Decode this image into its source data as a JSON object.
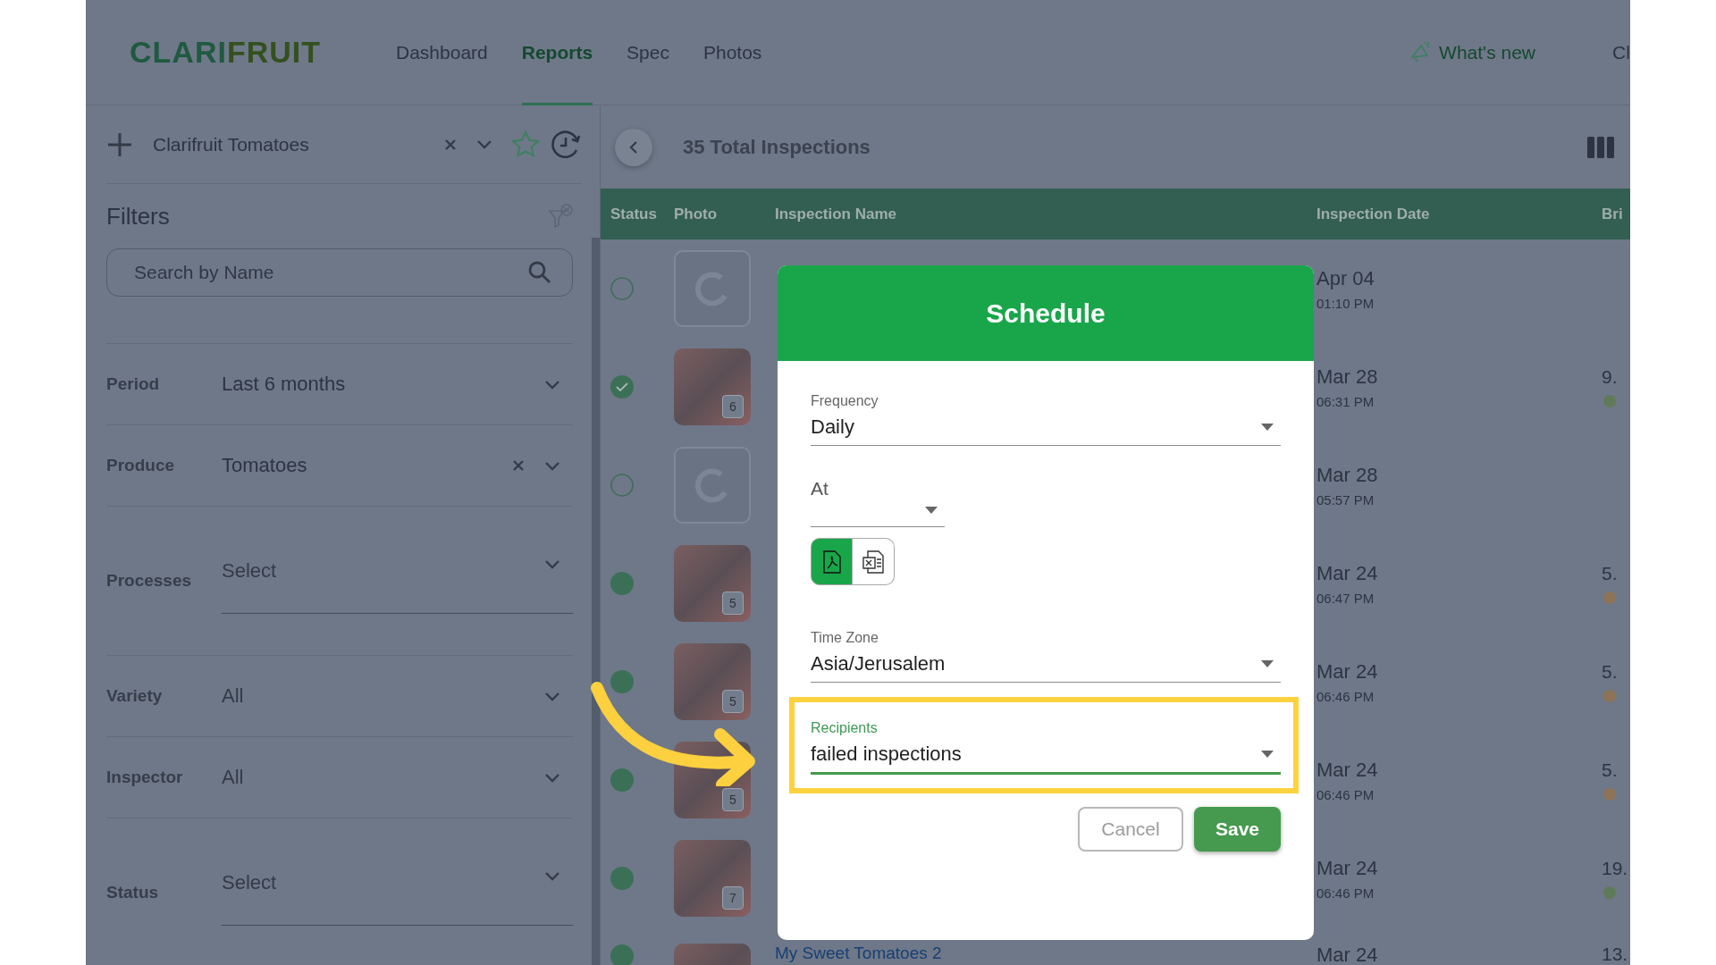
{
  "header": {
    "logo_parts": [
      "CLARI",
      "FRUIT"
    ],
    "nav": [
      {
        "label": "Dashboard",
        "selected": false
      },
      {
        "label": "Reports",
        "selected": true
      },
      {
        "label": "Spec",
        "selected": false
      },
      {
        "label": "Photos",
        "selected": false
      }
    ],
    "whats_new": "What's new",
    "cut_item": "Cl"
  },
  "sidebar": {
    "report_name": "Clarifruit Tomatoes",
    "filters_title": "Filters",
    "search": {
      "placeholder": "Search by Name"
    },
    "filters": [
      {
        "label": "Period",
        "value": "Last 6 months",
        "kind": "inline",
        "clearable": false
      },
      {
        "label": "Produce",
        "value": "Tomatoes",
        "kind": "inline",
        "clearable": true
      },
      {
        "label": "Processes",
        "placeholder": "Select",
        "kind": "underlined",
        "clearable": false
      },
      {
        "label": "Variety",
        "placeholder": "All",
        "kind": "inline",
        "clearable": false
      },
      {
        "label": "Inspector",
        "placeholder": "All",
        "kind": "inline",
        "clearable": false
      },
      {
        "label": "Status",
        "placeholder": "Select",
        "kind": "underlined",
        "clearable": false
      }
    ]
  },
  "content": {
    "title": "35 Total Inspections",
    "columns": [
      "Status",
      "Photo",
      "Inspection Name",
      "Inspection Date",
      "Bri"
    ],
    "rows": [
      {
        "status": {
          "kind": "pending"
        },
        "photo": {
          "kind": "loading"
        },
        "date": "Apr 04",
        "time": "01:10 PM"
      },
      {
        "status": {
          "kind": "approved"
        },
        "photo": {
          "kind": "photo",
          "count": "6"
        },
        "date": "Mar 28",
        "time": "06:31 PM",
        "bri": "9.",
        "color": "#5f7a58"
      },
      {
        "status": {
          "kind": "pending"
        },
        "photo": {
          "kind": "loading"
        },
        "date": "Mar 28",
        "time": "05:57 PM"
      },
      {
        "status": {
          "kind": "done"
        },
        "photo": {
          "kind": "photo",
          "count": "5"
        },
        "date": "Mar 24",
        "time": "06:47 PM",
        "bri": "5.",
        "color": "#8d7458"
      },
      {
        "status": {
          "kind": "done"
        },
        "photo": {
          "kind": "photo",
          "count": "5"
        },
        "date": "Mar 24",
        "time": "06:46 PM",
        "bri": "5.",
        "color": "#8d7458"
      },
      {
        "status": {
          "kind": "done"
        },
        "photo": {
          "kind": "photo",
          "count": "5"
        },
        "date": "Mar 24",
        "time": "06:46 PM",
        "bri": "5.",
        "color": "#8d7458"
      },
      {
        "status": {
          "kind": "done"
        },
        "photo": {
          "kind": "photo",
          "count": "7"
        },
        "date": "Mar 24",
        "time": "06:46 PM",
        "bri": "19.",
        "color": "#5f7a58"
      },
      {
        "status": {
          "kind": "done"
        },
        "photo": {
          "kind": "photo"
        },
        "name": "My Sweet Tomatoes 2",
        "date": "Mar 24",
        "bri": "13."
      }
    ]
  },
  "dialog": {
    "title": "Schedule",
    "fields": [
      {
        "label": "Frequency",
        "value": "Daily",
        "kind": "full",
        "highlighted": false
      },
      {
        "label": "At",
        "kind": "short",
        "highlighted": false
      },
      {
        "kind": "formats",
        "formats": [
          {
            "kind": "pdf",
            "selected": true
          },
          {
            "kind": "excel",
            "selected": false
          }
        ]
      },
      {
        "label": "Time Zone",
        "value": "Asia/Jerusalem",
        "kind": "full",
        "highlighted": false
      },
      {
        "label": "Recipients",
        "value": "failed inspections",
        "kind": "full",
        "highlighted": true
      }
    ],
    "buttons": [
      {
        "label": "Cancel",
        "kind": "secondary"
      },
      {
        "label": "Save",
        "kind": "primary"
      }
    ]
  }
}
